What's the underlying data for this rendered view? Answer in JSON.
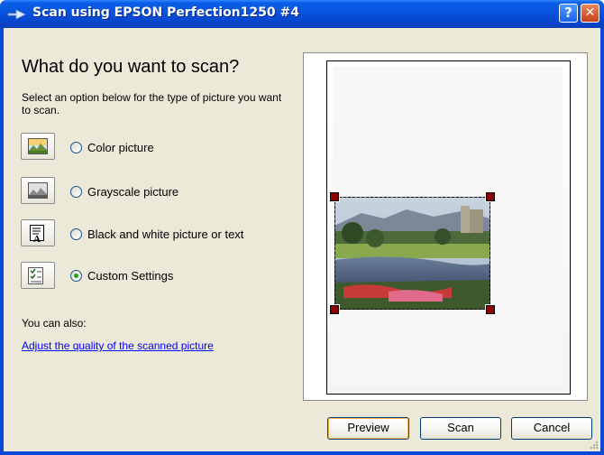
{
  "window": {
    "title": "Scan using EPSON Perfection1250 #4",
    "help_glyph": "?",
    "close_glyph": "✕"
  },
  "heading": "What do you want to scan?",
  "instructions": "Select an option below for the type of picture you want to scan.",
  "options": [
    {
      "label": "Color picture",
      "icon": "color-picture-icon",
      "selected": false
    },
    {
      "label": "Grayscale picture",
      "icon": "grayscale-picture-icon",
      "selected": false
    },
    {
      "label": "Black and white picture or text",
      "icon": "black-white-text-icon",
      "selected": false
    },
    {
      "label": "Custom Settings",
      "icon": "custom-settings-icon",
      "selected": true
    }
  ],
  "also_label": "You can also:",
  "adjust_link": "Adjust the quality of the scanned picture",
  "buttons": {
    "preview": "Preview",
    "scan": "Scan",
    "cancel": "Cancel"
  },
  "colors": {
    "titlebar": "#0852dc",
    "dialog_bg": "#ece9d8",
    "link": "#0000ff",
    "handle": "#8b0000",
    "radio_dot": "#21a121"
  }
}
